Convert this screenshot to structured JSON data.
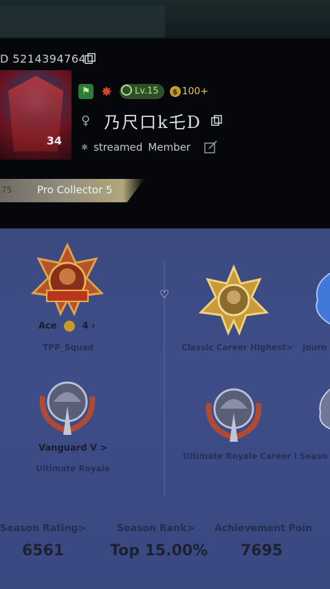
{
  "profile": {
    "uid": "D 5214394764",
    "level_badge": "Lv.15",
    "coins": "100+",
    "name": "乃尺口k乇D",
    "gender_symbol": "♀",
    "status": "streamed",
    "role": "Member",
    "avatar_level": "34"
  },
  "collector": {
    "title": "Pro Collector 5",
    "number": "75"
  },
  "tiers": {
    "ace": {
      "name": "Ace",
      "stars": "4",
      "mode": "TPP_Squad"
    },
    "classic": {
      "label": "Classic Career Highest>"
    },
    "journey": {
      "label": "Journ"
    },
    "vanguard": {
      "name": "Vanguard V",
      "arrow": ">",
      "mode": "Ultimate Royale"
    },
    "ultimate": {
      "label": "Ultimate Royale Career I"
    },
    "season_right": {
      "label": "Seaso"
    }
  },
  "stats": {
    "rating": {
      "label": "Season Rating>",
      "value": "6561"
    },
    "rank": {
      "label": "Season Rank>",
      "value": "Top 15.00%"
    },
    "points": {
      "label": "Achievement Poin",
      "value": "7695"
    }
  },
  "icons": [
    "copy-icon",
    "gender-icon",
    "edit-icon",
    "heart-icon",
    "chevron-icon"
  ],
  "colors": {
    "panel": "#3b4a7f",
    "header": "#05070a",
    "gold": "#c79b2a",
    "green": "#2f7a3a"
  }
}
